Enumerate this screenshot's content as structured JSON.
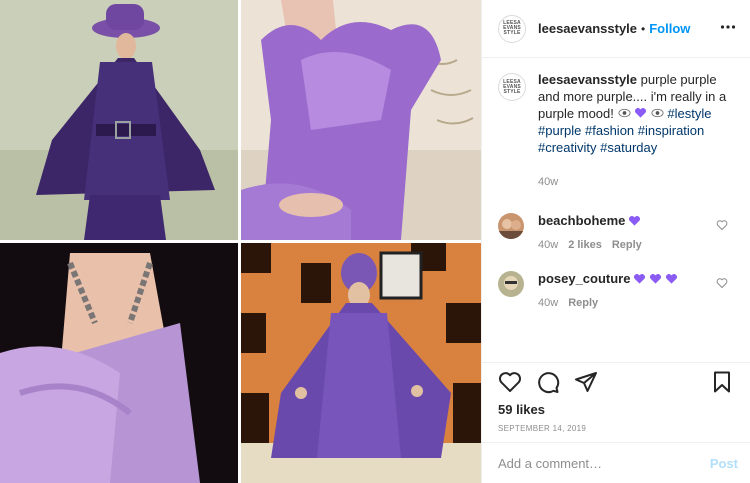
{
  "colors": {
    "accent": "#0095f6",
    "tag": "#00376b",
    "muted": "#8e8e8e",
    "purple_heart": "#8a5cf5",
    "post_disabled": "#b2dffc"
  },
  "media": {
    "tiles": [
      {
        "name": "photo-purple-cape-hat"
      },
      {
        "name": "photo-ruffle-dress"
      },
      {
        "name": "photo-chain-back-dress"
      },
      {
        "name": "photo-turban-caftan"
      }
    ]
  },
  "header": {
    "username": "leesaevansstyle",
    "separator": "•",
    "follow_label": "Follow",
    "logo_text": "LEESA EVANS STYLE",
    "more_icon": "more-horizontal-icon"
  },
  "caption": {
    "username": "leesaevansstyle",
    "text": "purple purple and more purple.... i'm really in a purple mood! ",
    "emoji": [
      "eye-emoji",
      "purple-heart-emoji",
      "eye-emoji"
    ],
    "hashtags": [
      "#lestyle",
      "#purple",
      "#fashion",
      "#inspiration",
      "#creativity",
      "#saturday"
    ],
    "time": "40w"
  },
  "comments": [
    {
      "username": "beachboheme",
      "hearts": 1,
      "time": "40w",
      "likes": "2 likes",
      "reply": "Reply"
    },
    {
      "username": "posey_couture",
      "hearts": 3,
      "time": "40w",
      "likes": "",
      "reply": "Reply"
    }
  ],
  "actions": {
    "icons": [
      "heart-icon",
      "comment-icon",
      "share-icon",
      "bookmark-icon"
    ],
    "likes": "59 likes",
    "date": "SEPTEMBER 14, 2019"
  },
  "add_comment": {
    "placeholder": "Add a comment…",
    "post_label": "Post"
  }
}
